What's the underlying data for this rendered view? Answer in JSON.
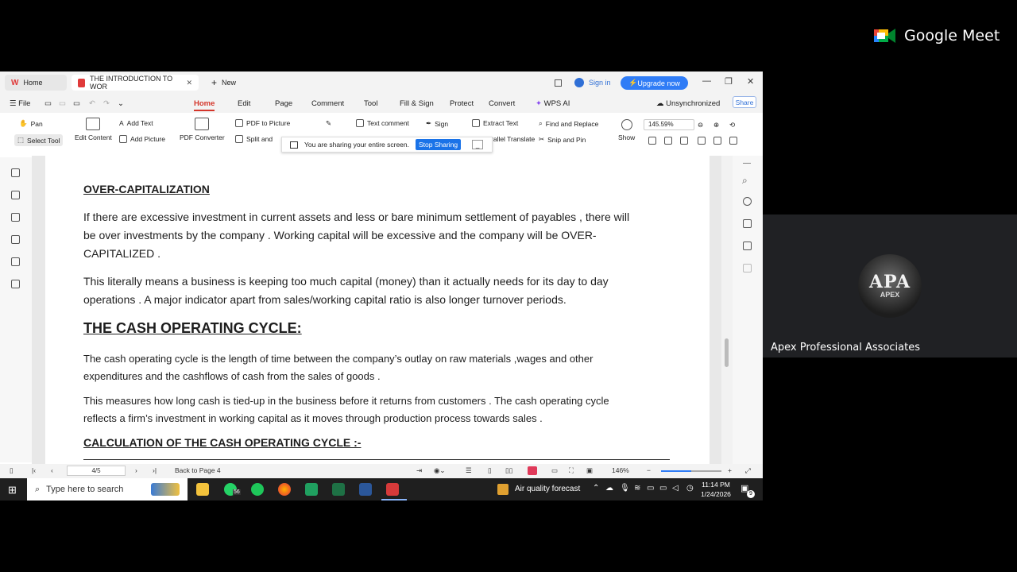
{
  "meet": {
    "brand": "Google Meet",
    "participant_name": "Apex Professional Associates",
    "avatar_text_big": "APA",
    "avatar_text_small": "APEX"
  },
  "titlebar": {
    "home_tab": "Home",
    "doc_tab": "THE INTRODUCTION TO WOR",
    "new_tab": "New",
    "sign_in": "Sign in",
    "upgrade": "Upgrade now"
  },
  "menu": {
    "file": "File",
    "items": [
      "Home",
      "Edit",
      "Page",
      "Comment",
      "Tool",
      "Fill & Sign",
      "Protect",
      "Convert",
      "WPS AI"
    ],
    "sync_status": "Unsynchronized",
    "share": "Share"
  },
  "ribbon": {
    "pan": "Pan",
    "select_tool": "Select Tool",
    "edit_content": "Edit Content",
    "add_text": "Add Text",
    "add_picture": "Add Picture",
    "pdf_converter": "PDF Converter",
    "pdf_to_picture": "PDF to Picture",
    "split": "Split and",
    "text_comment": "Text comment",
    "sign": "Sign",
    "extract_text": "Extract Text",
    "find_replace": "Find and Replace",
    "parallel_translate": "rallel Translate",
    "snip_pin": "Snip and Pin",
    "show": "Show",
    "zoom_value": "145.59%"
  },
  "share_banner": {
    "message": "You are sharing your entire screen.",
    "stop": "Stop Sharing",
    "minimize": "_"
  },
  "document": {
    "heading1": "OVER-CAPITALIZATION",
    "para1_line1": "If there are excessive investment in current assets and less or bare minimum settlement of payables , there will",
    "para1_line2": "be over investments by the company . Working capital will be excessive and the company will be OVER-",
    "para1_line3": "CAPITALIZED .",
    "para2_line1": "This literally means a business is keeping too much capital (money) than it actually needs for its day to day",
    "para2_line2": "operations . A major indicator apart from sales/working capital ratio is also longer turnover periods.",
    "heading2": "THE CASH OPERATING CYCLE:",
    "para3_line1": "The cash operating cycle is the length of time between the company’s outlay on raw materials ,wages  and other",
    "para3_line2": "expenditures and the cashflows of cash from the sales of goods .",
    "para4_line1": "This measures how long cash is tied-up in the business before it returns from customers . The cash operating cycle",
    "para4_line2": "reflects a firm’s investment in working capital as it moves through production process towards sales .",
    "heading3": "CALCULATION OF THE CASH OPERATING CYCLE :-"
  },
  "statusbar": {
    "page": "4/5",
    "back": "Back to Page 4",
    "zoom": "146%"
  },
  "taskbar": {
    "search_placeholder": "Type here to search",
    "whatsapp_badge": "56",
    "weather": "Air quality forecast",
    "time": "11:14 PM",
    "date": "1/24/2026",
    "notif": "9"
  },
  "colors": {
    "accent": "#d4352a",
    "meet_bg": "#202124",
    "stop_sharing": "#1a73e8",
    "upgrade": "#2f7cf6"
  }
}
